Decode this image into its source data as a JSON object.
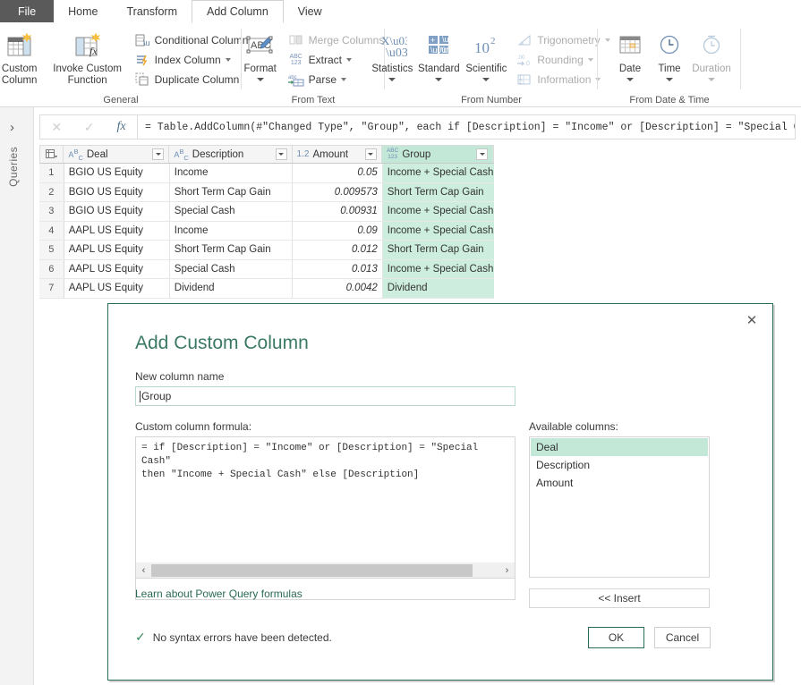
{
  "ribbon": {
    "tabs": [
      {
        "label": "File",
        "style": "file"
      },
      {
        "label": "Home",
        "style": "normal"
      },
      {
        "label": "Transform",
        "style": "normal"
      },
      {
        "label": "Add Column",
        "style": "active"
      },
      {
        "label": "View",
        "style": "normal"
      }
    ],
    "groups": {
      "general": {
        "label": "General",
        "custom_column": "Custom\nColumn",
        "custom_column_l1": "Custom",
        "custom_column_l2": "Column",
        "invoke_l1": "Invoke Custom",
        "invoke_l2": "Function",
        "conditional_column": "Conditional Column",
        "index_column": "Index Column",
        "duplicate_column": "Duplicate Column"
      },
      "from_text": {
        "label": "From Text",
        "format": "Format",
        "merge_columns": "Merge Columns",
        "extract": "Extract",
        "parse": "Parse"
      },
      "from_number": {
        "label": "From Number",
        "statistics": "Statistics",
        "standard": "Standard",
        "scientific": "Scientific",
        "trigonometry": "Trigonometry",
        "rounding": "Rounding",
        "information": "Information"
      },
      "from_date_time": {
        "label": "From Date & Time",
        "date": "Date",
        "time": "Time",
        "duration": "Duration"
      }
    }
  },
  "sidebar": {
    "chevron": "›",
    "queries_label": "Queries"
  },
  "formula_bar": {
    "cancel_icon": "✕",
    "accept_icon": "✓",
    "fx_icon": "fx",
    "value": "= Table.AddColumn(#\"Changed Type\", \"Group\", each if [Description] = \"Income\" or [Description] = \"Special Cash\""
  },
  "grid": {
    "columns": [
      {
        "name": "Deal",
        "type_icon": "ABC-text",
        "type_label": "Aᴮᴄ"
      },
      {
        "name": "Description",
        "type_icon": "ABC-text",
        "type_label": "Aᴮᴄ"
      },
      {
        "name": "Amount",
        "type_icon": "decimal",
        "type_label": "1.2"
      },
      {
        "name": "Group",
        "type_icon": "any",
        "type_label": "ABC 123"
      }
    ],
    "rows": [
      {
        "n": "1",
        "deal": "BGIO US Equity",
        "description": "Income",
        "amount": "0.05",
        "group": "Income + Special Cash"
      },
      {
        "n": "2",
        "deal": "BGIO US Equity",
        "description": "Short Term Cap Gain",
        "amount": "0.009573",
        "group": "Short Term Cap Gain"
      },
      {
        "n": "3",
        "deal": "BGIO US Equity",
        "description": "Special Cash",
        "amount": "0.00931",
        "group": "Income + Special Cash"
      },
      {
        "n": "4",
        "deal": "AAPL US Equity",
        "description": "Income",
        "amount": "0.09",
        "group": "Income + Special Cash"
      },
      {
        "n": "5",
        "deal": "AAPL US Equity",
        "description": "Short Term Cap Gain",
        "amount": "0.012",
        "group": "Short Term Cap Gain"
      },
      {
        "n": "6",
        "deal": "AAPL US Equity",
        "description": "Special Cash",
        "amount": "0.013",
        "group": "Income + Special Cash"
      },
      {
        "n": "7",
        "deal": "AAPL US Equity",
        "description": "Dividend",
        "amount": "0.0042",
        "group": "Dividend"
      }
    ]
  },
  "dialog": {
    "title": "Add Custom Column",
    "close_icon": "✕",
    "new_column_name_label": "New column name",
    "new_column_name_value": "Group",
    "formula_label": "Custom column formula:",
    "formula_value": "= if [Description] = \"Income\" or [Description] = \"Special Cash\"\nthen \"Income + Special Cash\" else [Description]",
    "scroll_left_icon": "‹",
    "scroll_right_icon": "›",
    "learn_link": "Learn about Power Query formulas",
    "available_columns_label": "Available columns:",
    "available_columns": [
      "Deal",
      "Description",
      "Amount"
    ],
    "available_selected": "Deal",
    "insert_label": "<< Insert",
    "status_icon": "✓",
    "status_text": "No syntax errors have been detected.",
    "ok_label": "OK",
    "cancel_label": "Cancel"
  },
  "colors": {
    "accent_green": "#2b6b56",
    "highlight_mint": "#cdeede",
    "file_tab_gray": "#5a5a5a"
  }
}
